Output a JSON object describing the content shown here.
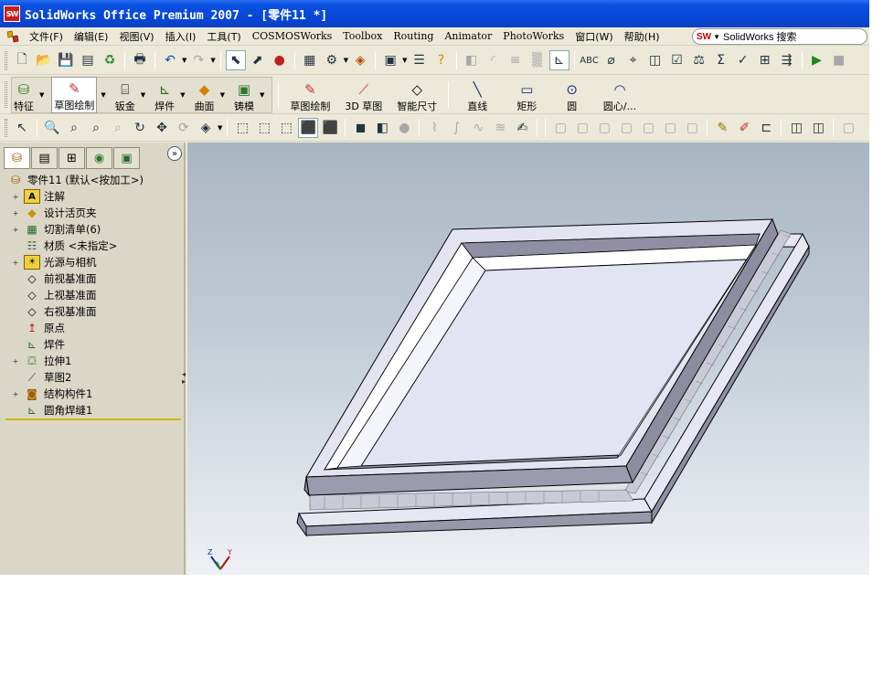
{
  "window": {
    "title": "SolidWorks Office Premium 2007 - [零件11 *]",
    "app_icon_text": "SW"
  },
  "menu": {
    "items": [
      "文件(F)",
      "编辑(E)",
      "视图(V)",
      "插入(I)",
      "工具(T)",
      "COSMOSWorks",
      "Toolbox",
      "Routing",
      "Animator",
      "PhotoWorks",
      "窗口(W)",
      "帮助(H)"
    ],
    "search_label": "SolidWorks 搜索"
  },
  "command_manager": {
    "tabs": [
      {
        "label": "特征",
        "icon": "features-icon"
      },
      {
        "label": "草图绘制",
        "icon": "sketch-icon"
      },
      {
        "label": "钣金",
        "icon": "sheetmetal-icon"
      },
      {
        "label": "焊件",
        "icon": "weldments-icon"
      },
      {
        "label": "曲面",
        "icon": "surfaces-icon"
      },
      {
        "label": "铸模",
        "icon": "mold-icon"
      }
    ],
    "sketch_tools": [
      {
        "label": "草图绘制",
        "icon": "sketch-icon"
      },
      {
        "label": "3D 草图",
        "icon": "3d-sketch-icon"
      },
      {
        "label": "智能尺寸",
        "icon": "smart-dimension-icon"
      },
      {
        "label": "直线",
        "icon": "line-icon"
      },
      {
        "label": "矩形",
        "icon": "rectangle-icon"
      },
      {
        "label": "圆",
        "icon": "circle-icon"
      },
      {
        "label": "圆心/...",
        "icon": "centerpoint-arc-icon"
      }
    ]
  },
  "feature_tree": {
    "root_label": "零件11  (默认<按加工>)",
    "items": [
      {
        "label": "注解",
        "icon": "annotations-icon",
        "expandable": true
      },
      {
        "label": "设计活页夹",
        "icon": "design-binder-icon",
        "expandable": true
      },
      {
        "label": "切割清单(6)",
        "icon": "cut-list-icon",
        "expandable": true
      },
      {
        "label": "材质 <未指定>",
        "icon": "material-icon",
        "expandable": false
      },
      {
        "label": "光源与相机",
        "icon": "lights-cameras-icon",
        "expandable": true
      },
      {
        "label": "前视基准面",
        "icon": "plane-icon",
        "expandable": false
      },
      {
        "label": "上视基准面",
        "icon": "plane-icon",
        "expandable": false
      },
      {
        "label": "右视基准面",
        "icon": "plane-icon",
        "expandable": false
      },
      {
        "label": "原点",
        "icon": "origin-icon",
        "expandable": false
      },
      {
        "label": "焊件",
        "icon": "weldment-icon",
        "expandable": false
      },
      {
        "label": "拉伸1",
        "icon": "extrude-icon",
        "expandable": true
      },
      {
        "label": "草图2",
        "icon": "sketch-icon",
        "expandable": false
      },
      {
        "label": "结构构件1",
        "icon": "structural-member-icon",
        "expandable": true
      },
      {
        "label": "圆角焊缝1",
        "icon": "fillet-bead-icon",
        "expandable": false
      }
    ]
  },
  "viewport": {
    "triad_labels": {
      "z": "Z",
      "y": "Y",
      "x": "X"
    },
    "colors": {
      "bg_top": "#a8b6c3",
      "bg_bottom": "#eef1f4",
      "part_face": "#9a99ad",
      "part_top": "#e2e3f0",
      "weld_bead": "#c7c8d2"
    }
  }
}
